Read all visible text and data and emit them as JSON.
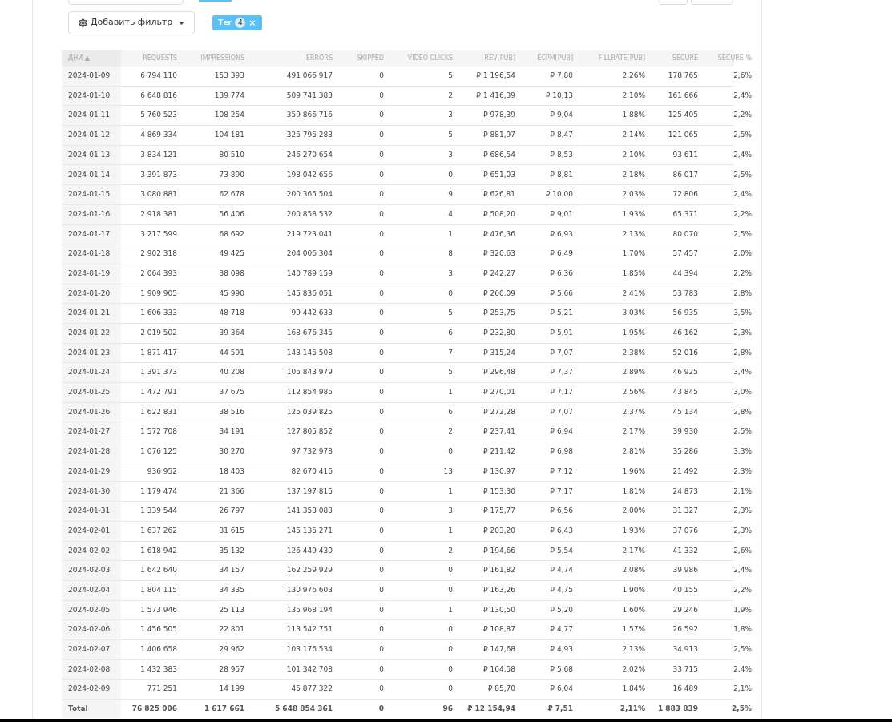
{
  "filter_button": {
    "label": "Добавить фильтр"
  },
  "tag": {
    "label": "Тег",
    "count": "4",
    "close": "×"
  },
  "table": {
    "columns": [
      "ДНИ ▲",
      "REQUESTS",
      "IMPRESSIONS",
      "ERRORS",
      "SKIPPED",
      "VIDEO CLICKS",
      "REV[PUB]",
      "ECPM[PUB]",
      "FILLRATE[PUB]",
      "SECURE",
      "SECURE %"
    ],
    "rows": [
      [
        "2024-01-09",
        "6 794 110",
        "153 393",
        "491 066 917",
        "0",
        "5",
        "₽ 1 196,54",
        "₽ 7,80",
        "2,26%",
        "178 765",
        "2,6%"
      ],
      [
        "2024-01-10",
        "6 648 816",
        "139 774",
        "509 741 383",
        "0",
        "2",
        "₽ 1 416,39",
        "₽ 10,13",
        "2,10%",
        "161 666",
        "2,4%"
      ],
      [
        "2024-01-11",
        "5 760 523",
        "108 254",
        "359 866 716",
        "0",
        "3",
        "₽ 978,39",
        "₽ 9,04",
        "1,88%",
        "125 405",
        "2,2%"
      ],
      [
        "2024-01-12",
        "4 869 334",
        "104 181",
        "325 795 283",
        "0",
        "5",
        "₽ 881,97",
        "₽ 8,47",
        "2,14%",
        "121 065",
        "2,5%"
      ],
      [
        "2024-01-13",
        "3 834 121",
        "80 510",
        "246 270 654",
        "0",
        "3",
        "₽ 686,54",
        "₽ 8,53",
        "2,10%",
        "93 611",
        "2,4%"
      ],
      [
        "2024-01-14",
        "3 391 873",
        "73 890",
        "198 042 656",
        "0",
        "0",
        "₽ 651,03",
        "₽ 8,81",
        "2,18%",
        "86 017",
        "2,5%"
      ],
      [
        "2024-01-15",
        "3 080 881",
        "62 678",
        "200 365 504",
        "0",
        "9",
        "₽ 626,81",
        "₽ 10,00",
        "2,03%",
        "72 806",
        "2,4%"
      ],
      [
        "2024-01-16",
        "2 918 381",
        "56 406",
        "200 858 532",
        "0",
        "4",
        "₽ 508,20",
        "₽ 9,01",
        "1,93%",
        "65 371",
        "2,2%"
      ],
      [
        "2024-01-17",
        "3 217 599",
        "68 692",
        "219 723 041",
        "0",
        "1",
        "₽ 476,36",
        "₽ 6,93",
        "2,13%",
        "80 070",
        "2,5%"
      ],
      [
        "2024-01-18",
        "2 902 318",
        "49 425",
        "204 006 304",
        "0",
        "8",
        "₽ 320,63",
        "₽ 6,49",
        "1,70%",
        "57 457",
        "2,0%"
      ],
      [
        "2024-01-19",
        "2 064 393",
        "38 098",
        "140 789 159",
        "0",
        "3",
        "₽ 242,27",
        "₽ 6,36",
        "1,85%",
        "44 394",
        "2,2%"
      ],
      [
        "2024-01-20",
        "1 909 905",
        "45 990",
        "145 836 051",
        "0",
        "0",
        "₽ 260,09",
        "₽ 5,66",
        "2,41%",
        "53 783",
        "2,8%"
      ],
      [
        "2024-01-21",
        "1 606 333",
        "48 718",
        "99 442 633",
        "0",
        "5",
        "₽ 253,75",
        "₽ 5,21",
        "3,03%",
        "56 935",
        "3,5%"
      ],
      [
        "2024-01-22",
        "2 019 502",
        "39 364",
        "168 676 345",
        "0",
        "6",
        "₽ 232,80",
        "₽ 5,91",
        "1,95%",
        "46 162",
        "2,3%"
      ],
      [
        "2024-01-23",
        "1 871 417",
        "44 591",
        "143 145 508",
        "0",
        "7",
        "₽ 315,24",
        "₽ 7,07",
        "2,38%",
        "52 016",
        "2,8%"
      ],
      [
        "2024-01-24",
        "1 391 373",
        "40 208",
        "105 843 979",
        "0",
        "5",
        "₽ 296,48",
        "₽ 7,37",
        "2,89%",
        "46 925",
        "3,4%"
      ],
      [
        "2024-01-25",
        "1 472 791",
        "37 675",
        "112 854 985",
        "0",
        "1",
        "₽ 270,01",
        "₽ 7,17",
        "2,56%",
        "43 845",
        "3,0%"
      ],
      [
        "2024-01-26",
        "1 622 831",
        "38 516",
        "125 039 825",
        "0",
        "6",
        "₽ 272,28",
        "₽ 7,07",
        "2,37%",
        "45 134",
        "2,8%"
      ],
      [
        "2024-01-27",
        "1 572 708",
        "34 191",
        "127 805 852",
        "0",
        "2",
        "₽ 237,41",
        "₽ 6,94",
        "2,17%",
        "39 930",
        "2,5%"
      ],
      [
        "2024-01-28",
        "1 076 125",
        "30 270",
        "97 732 978",
        "0",
        "0",
        "₽ 211,42",
        "₽ 6,98",
        "2,81%",
        "35 286",
        "3,3%"
      ],
      [
        "2024-01-29",
        "936 952",
        "18 403",
        "82 670 416",
        "0",
        "13",
        "₽ 130,97",
        "₽ 7,12",
        "1,96%",
        "21 492",
        "2,3%"
      ],
      [
        "2024-01-30",
        "1 179 474",
        "21 366",
        "137 197 815",
        "0",
        "1",
        "₽ 153,30",
        "₽ 7,17",
        "1,81%",
        "24 873",
        "2,1%"
      ],
      [
        "2024-01-31",
        "1 339 544",
        "26 797",
        "141 353 083",
        "0",
        "3",
        "₽ 175,77",
        "₽ 6,56",
        "2,00%",
        "31 327",
        "2,3%"
      ],
      [
        "2024-02-01",
        "1 637 262",
        "31 615",
        "145 135 271",
        "0",
        "1",
        "₽ 203,20",
        "₽ 6,43",
        "1,93%",
        "37 076",
        "2,3%"
      ],
      [
        "2024-02-02",
        "1 618 942",
        "35 132",
        "126 449 430",
        "0",
        "2",
        "₽ 194,66",
        "₽ 5,54",
        "2,17%",
        "41 332",
        "2,6%"
      ],
      [
        "2024-02-03",
        "1 642 640",
        "34 157",
        "162 259 929",
        "0",
        "0",
        "₽ 161,82",
        "₽ 4,74",
        "2,08%",
        "39 986",
        "2,4%"
      ],
      [
        "2024-02-04",
        "1 804 115",
        "34 335",
        "130 976 603",
        "0",
        "0",
        "₽ 163,26",
        "₽ 4,75",
        "1,90%",
        "40 155",
        "2,2%"
      ],
      [
        "2024-02-05",
        "1 573 946",
        "25 113",
        "135 968 194",
        "0",
        "1",
        "₽ 130,50",
        "₽ 5,20",
        "1,60%",
        "29 246",
        "1,9%"
      ],
      [
        "2024-02-06",
        "1 456 505",
        "22 801",
        "113 542 751",
        "0",
        "0",
        "₽ 108,87",
        "₽ 4,77",
        "1,57%",
        "26 592",
        "1,8%"
      ],
      [
        "2024-02-07",
        "1 406 658",
        "29 962",
        "103 176 534",
        "0",
        "0",
        "₽ 147,68",
        "₽ 4,93",
        "2,13%",
        "34 913",
        "2,5%"
      ],
      [
        "2024-02-08",
        "1 432 383",
        "28 957",
        "101 342 708",
        "0",
        "0",
        "₽ 164,58",
        "₽ 5,68",
        "2,02%",
        "33 715",
        "2,4%"
      ],
      [
        "2024-02-09",
        "771 251",
        "14 199",
        "45 877 322",
        "0",
        "0",
        "₽ 85,70",
        "₽ 6,04",
        "1,84%",
        "16 489",
        "2,1%"
      ]
    ],
    "total": [
      "Total",
      "76 825 006",
      "1 617 661",
      "5 648 854 361",
      "0",
      "96",
      "₽ 12 154,94",
      "₽ 7,51",
      "2,11%",
      "1 883 839",
      "2,5%"
    ]
  }
}
